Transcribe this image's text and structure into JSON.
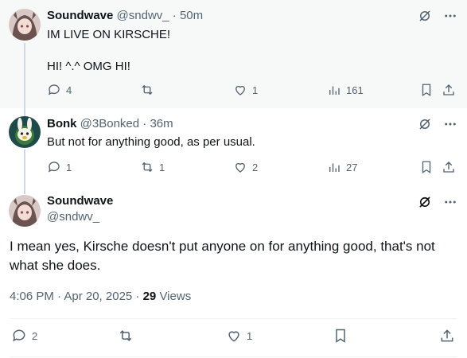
{
  "post1": {
    "name": "Soundwave",
    "meta": "@sndwv_ · 50m",
    "text": "IM LIVE ON KIRSCHE!\n\nHI! ^.^ OMG HI!",
    "replies": "4",
    "reposts": "",
    "likes": "1",
    "views": "161"
  },
  "post2": {
    "name": "Bonk",
    "meta": "@3Bonked · 36m",
    "text": "But not for anything good, as per usual.",
    "replies": "1",
    "reposts": "1",
    "likes": "2",
    "views": "27"
  },
  "main": {
    "name": "Soundwave",
    "handle": "@sndwv_",
    "text": "I mean yes, Kirsche doesn't put anyone on for anything good, that's not what she does.",
    "time": "4:06 PM · Apr 20, 2025 · ",
    "views_count": "29",
    "views_label": " Views",
    "replies": "2",
    "reposts": "",
    "likes": "1"
  },
  "colors": {
    "text": "#0f1419",
    "muted": "#536471",
    "thread": "#cfd9de",
    "highlight_bg": "#f7f9f9"
  },
  "icons": [
    "grok-icon",
    "more-icon",
    "reply-icon",
    "repost-icon",
    "like-icon",
    "views-icon",
    "bookmark-icon",
    "share-icon"
  ]
}
